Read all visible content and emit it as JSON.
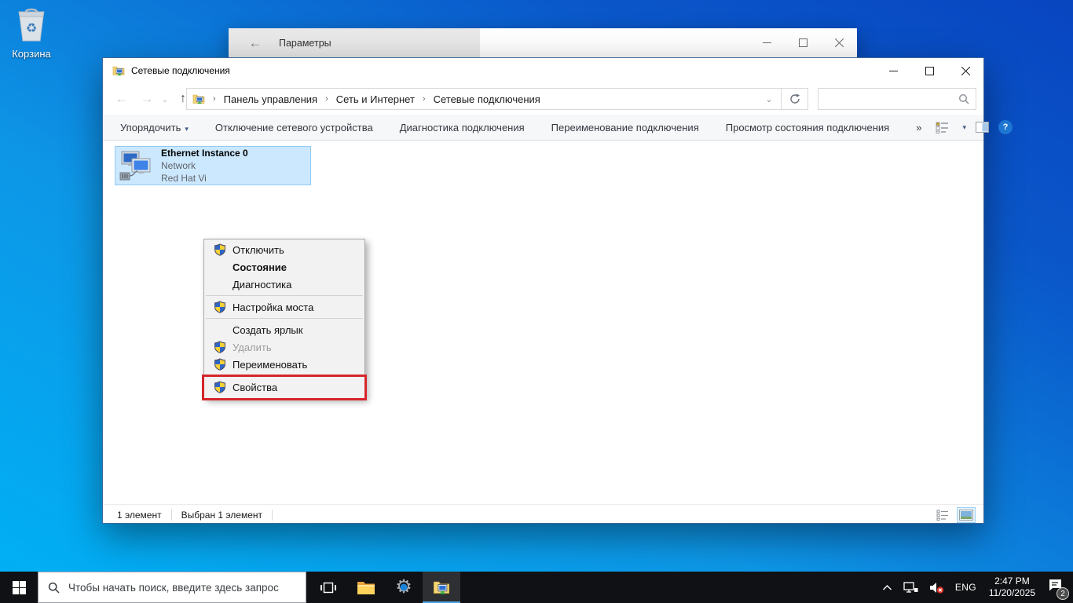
{
  "desktop": {
    "recycle_bin_label": "Корзина"
  },
  "settings_window": {
    "title": "Параметры"
  },
  "explorer": {
    "window_title": "Сетевые подключения",
    "breadcrumb": {
      "segments": [
        "Панель управления",
        "Сеть и Интернет",
        "Сетевые подключения"
      ]
    },
    "search_value": "",
    "toolbar": {
      "organize_label": "Упорядочить",
      "commands": [
        "Отключение сетевого устройства",
        "Диагностика подключения",
        "Переименование подключения",
        "Просмотр состояния подключения"
      ],
      "overflow_label": "»"
    },
    "connection": {
      "name": "Ethernet Instance 0",
      "network": "Network",
      "adapter": "Red Hat Vi"
    },
    "statusbar": {
      "items_count": "1 элемент",
      "selected_count": "Выбран 1 элемент"
    }
  },
  "context_menu": {
    "disable": "Отключить",
    "status": "Состояние",
    "diagnose": "Диагностика",
    "bridge": "Настройка моста",
    "shortcut": "Создать ярлык",
    "delete": "Удалить",
    "rename": "Переименовать",
    "properties": "Свойства"
  },
  "taskbar": {
    "search_placeholder": "Чтобы начать поиск, введите здесь запрос",
    "tray": {
      "language": "ENG",
      "time": "2:47 PM",
      "date": "11/20/2025",
      "badge": "2"
    }
  },
  "icons": {
    "back_arrow": "←",
    "forward_arrow": "→",
    "up_arrow": "↑",
    "dropdown": "⌄",
    "organize_caret": "▾",
    "layout_caret": "▾",
    "crumb_separator": "›",
    "help": "?",
    "recycle": "♻"
  },
  "colors": {
    "accent": "#0078d7",
    "selection": "#cce8ff",
    "annotation_red": "#d5262b",
    "desktop_bottom_left": "#00b1f6",
    "desktop_top_right": "#0845c0",
    "taskbar": "#101114"
  }
}
